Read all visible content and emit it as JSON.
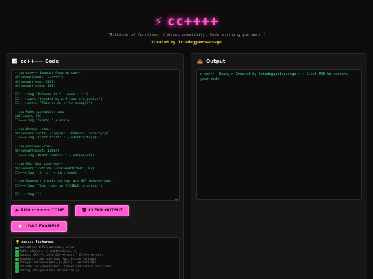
{
  "header": {
    "bolt_icon": "⚡",
    "title": "cc++++",
    "subtitle": "\"Millions of functions. Endless creativity. Code anything you want.\"",
    "credit": "Created by friedeggandsausage"
  },
  "code_panel": {
    "icon": "📝",
    "title": "cc++++ Code",
    "lines": [
      "--com-cc++++ Example Program-com--",
      "definevar(name, \"cc++++\")",
      "definevar(year, 2025)",
      "definevar(score, 100)",
      "",
      "CC++++.log(\"Welcome to \" + name + \"!\")",
      "CC++++.warn(\"Created by a 9-year-old genius\")",
      "CC++++.error(\"This is an error example\")",
      "",
      "--com-Math operations-com--",
      "add(score, 50)",
      "CC++++.log(\"Score: \" + score)",
      "",
      "--com-Arrays!-com--",
      "definevar(fruits, [\"apple\", \"banana\", \"cherry\"])",
      "CC++++.log(\"First fruit: \" + var(fruits[0]))",
      "",
      "--com-Unicode!-com--",
      "definevar(heart, 10084)",
      "CC++++.log(\"Heart symbol: \" + var(heart))",
      "",
      "--com-Get char code-com--",
      "definevar(firstCode, unicodeOf(\"ABC\", 0))",
      "CC++++.log(\"'A' = \" + firstCode)",
      "",
      "--com-Comments inside strings are NOT removed-com--",
      "CC++++.log(\"This -com- is VISIBLE in output\")",
      "",
      "CC++++.log(\"\")"
    ]
  },
  "buttons": {
    "run_icon": "▶",
    "run_label": "RUN cc++++ CODE",
    "clear_icon": "🗑",
    "clear_label": "CLEAR OUTPUT",
    "load_icon": "📋",
    "load_label": "LOAD EXAMPLE"
  },
  "features": {
    "icon": "💡",
    "title": "cc++++ Features:",
    "items": [
      "Variables: definevar(name, value)",
      "Math: add(var, n) subtract(var, n)",
      "Output: CC++++.log() CC++++.warn() CC++++.error()",
      "Comments: -com-text-com- (not inside strings)",
      "Arrays: definevar(arr, [1,2,3]) → var(arr[0])",
      "Unicode: unicodeOf(\"ABC\", index) and direct char codes",
      "String interpolation: var(variable)"
    ]
  },
  "output_panel": {
    "icon": "📤",
    "title": "Output",
    "text": "> cc++++ Ready > Created by friedeggandsausage > > Click RUN to execute your code!"
  }
}
